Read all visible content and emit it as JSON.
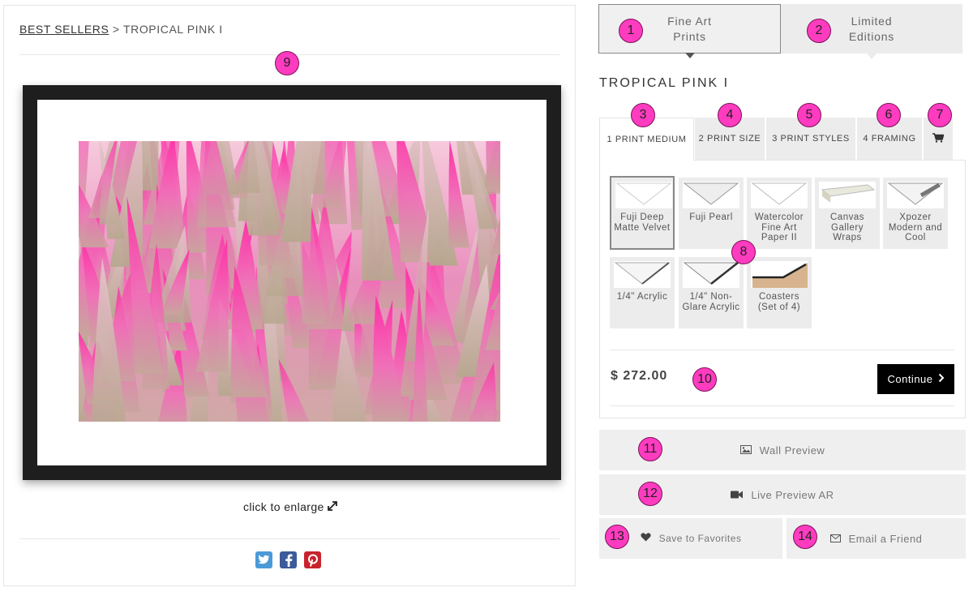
{
  "breadcrumb": {
    "parent": "BEST SELLERS",
    "separator": " > ",
    "current": "TROPICAL PINK I"
  },
  "enlarge_label": "click to enlarge",
  "product_types": [
    {
      "label": "Fine Art Prints"
    },
    {
      "label": "Limited Editions"
    }
  ],
  "product_title": "TROPICAL PINK I",
  "steps": [
    {
      "label": "1 PRINT MEDIUM"
    },
    {
      "label": "2 PRINT SIZE"
    },
    {
      "label": "3 PRINT STYLES"
    },
    {
      "label": "4 FRAMING"
    }
  ],
  "media": [
    {
      "label": "Fuji Deep Matte Velvet",
      "selected": true
    },
    {
      "label": "Fuji Pearl"
    },
    {
      "label": "Watercolor Fine Art Paper II"
    },
    {
      "label": "Canvas Gallery Wraps"
    },
    {
      "label": "Xpozer Modern and Cool"
    },
    {
      "label": "1/4\" Acrylic"
    },
    {
      "label": "1/4\" Non-Glare Acrylic"
    },
    {
      "label": "Coasters (Set of 4)"
    }
  ],
  "price": "$ 272.00",
  "continue_label": "Continue",
  "actions": {
    "wall_preview": "Wall Preview",
    "live_preview": "Live Preview AR",
    "favorites": "Save to Favorites",
    "email": "Email a Friend"
  },
  "annotations": [
    "1",
    "2",
    "3",
    "4",
    "5",
    "6",
    "7",
    "8",
    "9",
    "10",
    "11",
    "12",
    "13",
    "14"
  ],
  "colors": {
    "badge": "#ff3cc0",
    "frame": "#1e1e1e",
    "continue_bg": "#000000",
    "twitter": "#4a9ad8",
    "facebook": "#3b5b9a",
    "pinterest": "#c8232c"
  },
  "icons": [
    "cart-icon",
    "image-icon",
    "video-camera-icon",
    "heart-icon",
    "envelope-icon",
    "expand-icon",
    "twitter-icon",
    "facebook-icon",
    "pinterest-icon",
    "chevron-right-icon"
  ]
}
